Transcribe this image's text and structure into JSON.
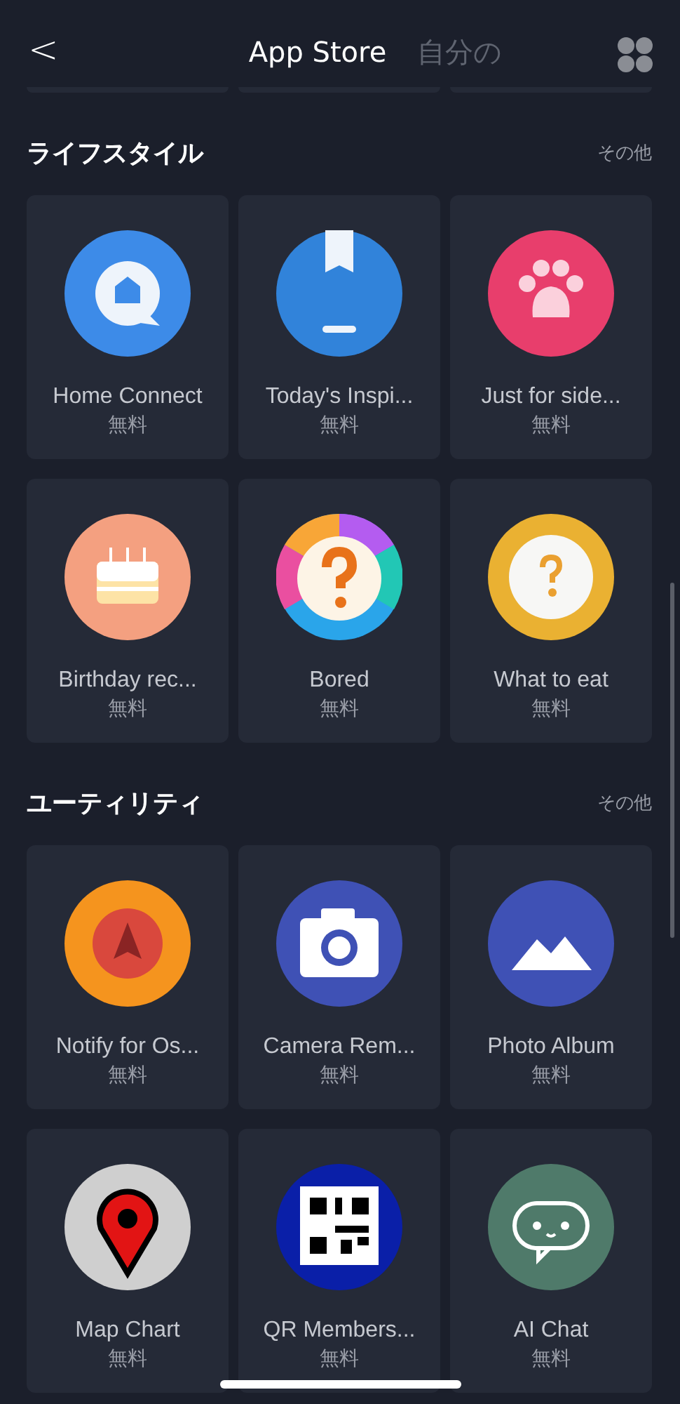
{
  "header": {
    "back": "<",
    "tabs": [
      {
        "label": "App Store",
        "selected": true
      },
      {
        "label": "自分の",
        "selected": false
      }
    ]
  },
  "sections": [
    {
      "title": "ライフスタイル",
      "more": "その他",
      "apps": [
        {
          "name": "Home Connect",
          "price": "無料"
        },
        {
          "name": "Today's Inspi...",
          "price": "無料"
        },
        {
          "name": "Just for side...",
          "price": "無料"
        },
        {
          "name": "Birthday rec...",
          "price": "無料"
        },
        {
          "name": "Bored",
          "price": "無料"
        },
        {
          "name": "What to eat",
          "price": "無料"
        }
      ]
    },
    {
      "title": "ユーティリティ",
      "more": "その他",
      "apps": [
        {
          "name": "Notify for Os...",
          "price": "無料"
        },
        {
          "name": "Camera Rem...",
          "price": "無料"
        },
        {
          "name": "Photo Album",
          "price": "無料"
        },
        {
          "name": "Map Chart",
          "price": "無料"
        },
        {
          "name": "QR Members...",
          "price": "無料"
        },
        {
          "name": "AI Chat",
          "price": "無料"
        }
      ]
    }
  ]
}
